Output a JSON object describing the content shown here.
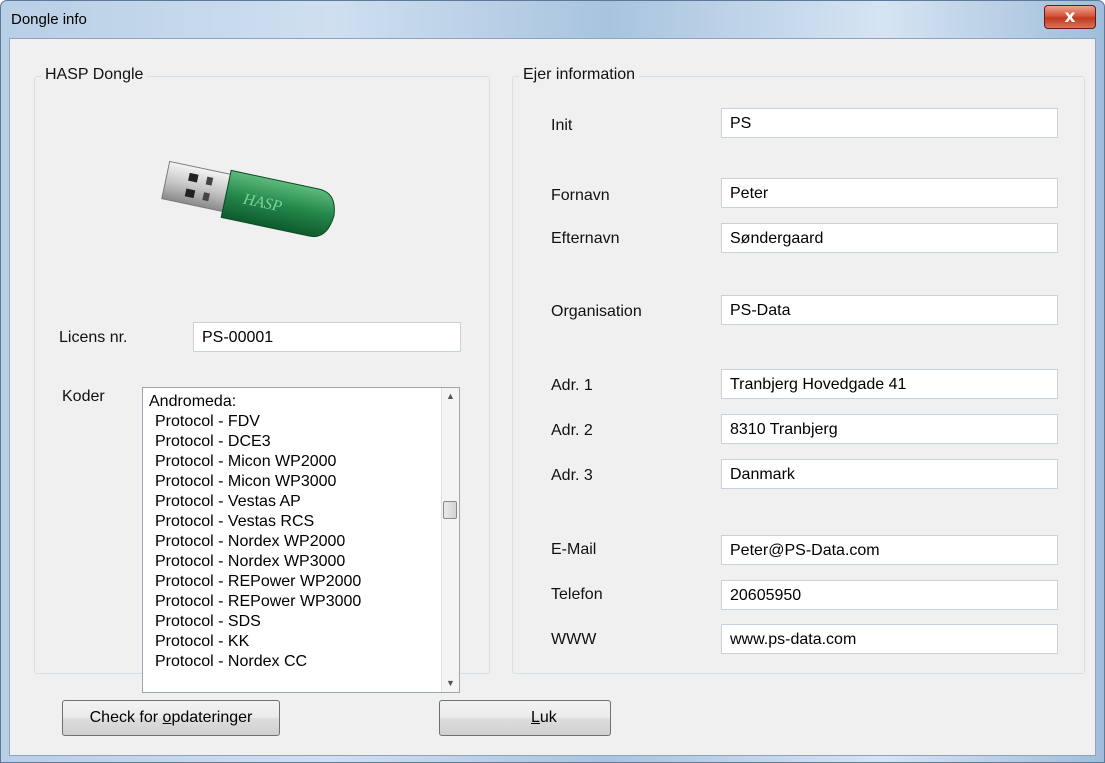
{
  "window": {
    "title": "Dongle info",
    "close_glyph": "x"
  },
  "hasp": {
    "group_title": "HASP Dongle",
    "dongle_label": "HASP",
    "license_label": "Licens nr.",
    "license_value": "PS-00001",
    "codes_label": "Koder",
    "codes": [
      "Andromeda:",
      "Protocol - FDV",
      "Protocol - DCE3",
      "Protocol - Micon WP2000",
      "Protocol - Micon WP3000",
      "Protocol - Vestas AP",
      "Protocol - Vestas RCS",
      "Protocol - Nordex WP2000",
      "Protocol - Nordex WP3000",
      "Protocol - REPower WP2000",
      "Protocol - REPower WP3000",
      "Protocol - SDS",
      "Protocol - KK",
      "Protocol - Nordex CC"
    ]
  },
  "owner": {
    "group_title": "Ejer information",
    "fields": [
      {
        "label": "Init",
        "value": "PS"
      },
      {
        "label": "Fornavn",
        "value": "Peter"
      },
      {
        "label": "Efternavn",
        "value": "Søndergaard"
      },
      {
        "label": "Organisation",
        "value": "PS-Data"
      },
      {
        "label": "Adr. 1",
        "value": "Tranbjerg Hovedgade 41"
      },
      {
        "label": "Adr. 2",
        "value": "8310 Tranbjerg"
      },
      {
        "label": "Adr. 3",
        "value": "Danmark"
      },
      {
        "label": "E-Mail",
        "value": "Peter@PS-Data.com"
      },
      {
        "label": "Telefon",
        "value": "20605950"
      },
      {
        "label": "WWW",
        "value": "www.ps-data.com"
      }
    ]
  },
  "buttons": {
    "check_prefix": "Check for ",
    "check_mnemonic": "o",
    "check_suffix": "pdateringer",
    "close_mnemonic": "L",
    "close_suffix": "uk"
  },
  "icons": {
    "close": "close-x-icon",
    "scroll_up": "scroll-up-arrow-icon",
    "scroll_down": "scroll-down-arrow-icon",
    "dongle": "usb-dongle-image"
  }
}
